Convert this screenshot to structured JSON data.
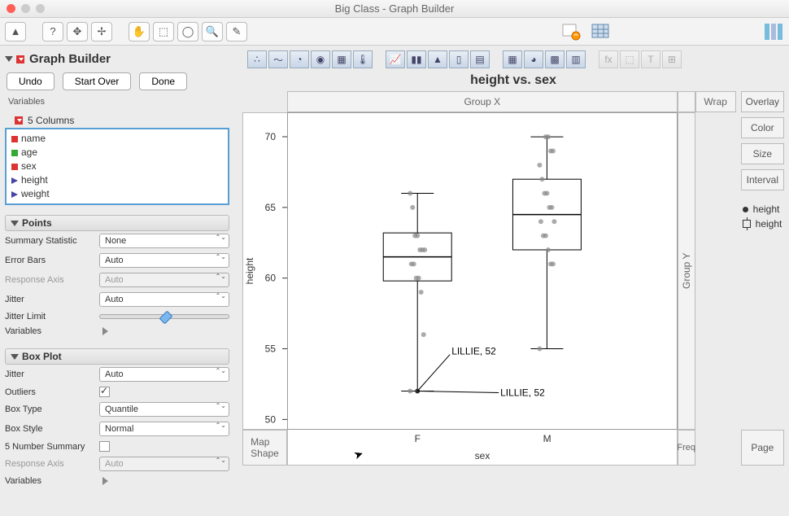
{
  "window": {
    "title": "Big Class - Graph Builder"
  },
  "header": {
    "title": "Graph Builder"
  },
  "buttons": {
    "undo": "Undo",
    "start_over": "Start Over",
    "done": "Done"
  },
  "variables": {
    "label": "Variables",
    "columns_header": "5 Columns",
    "columns": [
      "name",
      "age",
      "sex",
      "height",
      "weight"
    ]
  },
  "panels": {
    "points": {
      "title": "Points",
      "stat_label": "Summary Statistic",
      "stat_value": "None",
      "errorbars_label": "Error Bars",
      "errorbars_value": "Auto",
      "respaxis_label": "Response Axis",
      "respaxis_value": "Auto",
      "jitter_label": "Jitter",
      "jitter_value": "Auto",
      "jitterlimit_label": "Jitter Limit",
      "vars_label": "Variables"
    },
    "boxplot": {
      "title": "Box Plot",
      "jitter_label": "Jitter",
      "jitter_value": "Auto",
      "outliers_label": "Outliers",
      "boxtype_label": "Box Type",
      "boxtype_value": "Quantile",
      "boxstyle_label": "Box Style",
      "boxstyle_value": "Normal",
      "fivenum_label": "5 Number Summary",
      "respaxis_label": "Response Axis",
      "respaxis_value": "Auto",
      "vars_label": "Variables"
    }
  },
  "chart": {
    "title": "height vs. sex",
    "groupx": "Group X",
    "wrap": "Wrap",
    "overlay": "Overlay",
    "color": "Color",
    "size": "Size",
    "interval": "Interval",
    "groupy": "Group Y",
    "freq": "Freq",
    "page": "Page",
    "mapshape": "Map\nShape",
    "ylabel": "height",
    "xlabel": "sex",
    "legend": [
      {
        "sym": "dot",
        "text": "height"
      },
      {
        "sym": "box",
        "text": "height"
      }
    ],
    "annotation1": "LILLIE, 52",
    "annotation2": "LILLIE, 52"
  },
  "chart_data": {
    "type": "boxplot_with_points",
    "title": "height vs. sex",
    "xlabel": "sex",
    "ylabel": "height",
    "ylim": [
      50,
      71
    ],
    "yticks": [
      50,
      55,
      60,
      65,
      70
    ],
    "categories": [
      "F",
      "M"
    ],
    "boxes": [
      {
        "category": "F",
        "min": 52,
        "q1": 59.8,
        "median": 61.5,
        "q3": 63.2,
        "max": 66
      },
      {
        "category": "M",
        "min": 55,
        "q1": 62,
        "median": 64.5,
        "q3": 67,
        "max": 70
      }
    ],
    "points": {
      "F": [
        52,
        56,
        59,
        60,
        60,
        61,
        61,
        62,
        62,
        62,
        63,
        63,
        65,
        66
      ],
      "M": [
        55,
        61,
        61,
        62,
        63,
        63,
        64,
        64,
        65,
        65,
        66,
        66,
        67,
        68,
        69,
        69,
        70,
        70
      ]
    },
    "annotations": [
      {
        "text": "LILLIE, 52",
        "x": "F",
        "y": 52
      }
    ]
  }
}
